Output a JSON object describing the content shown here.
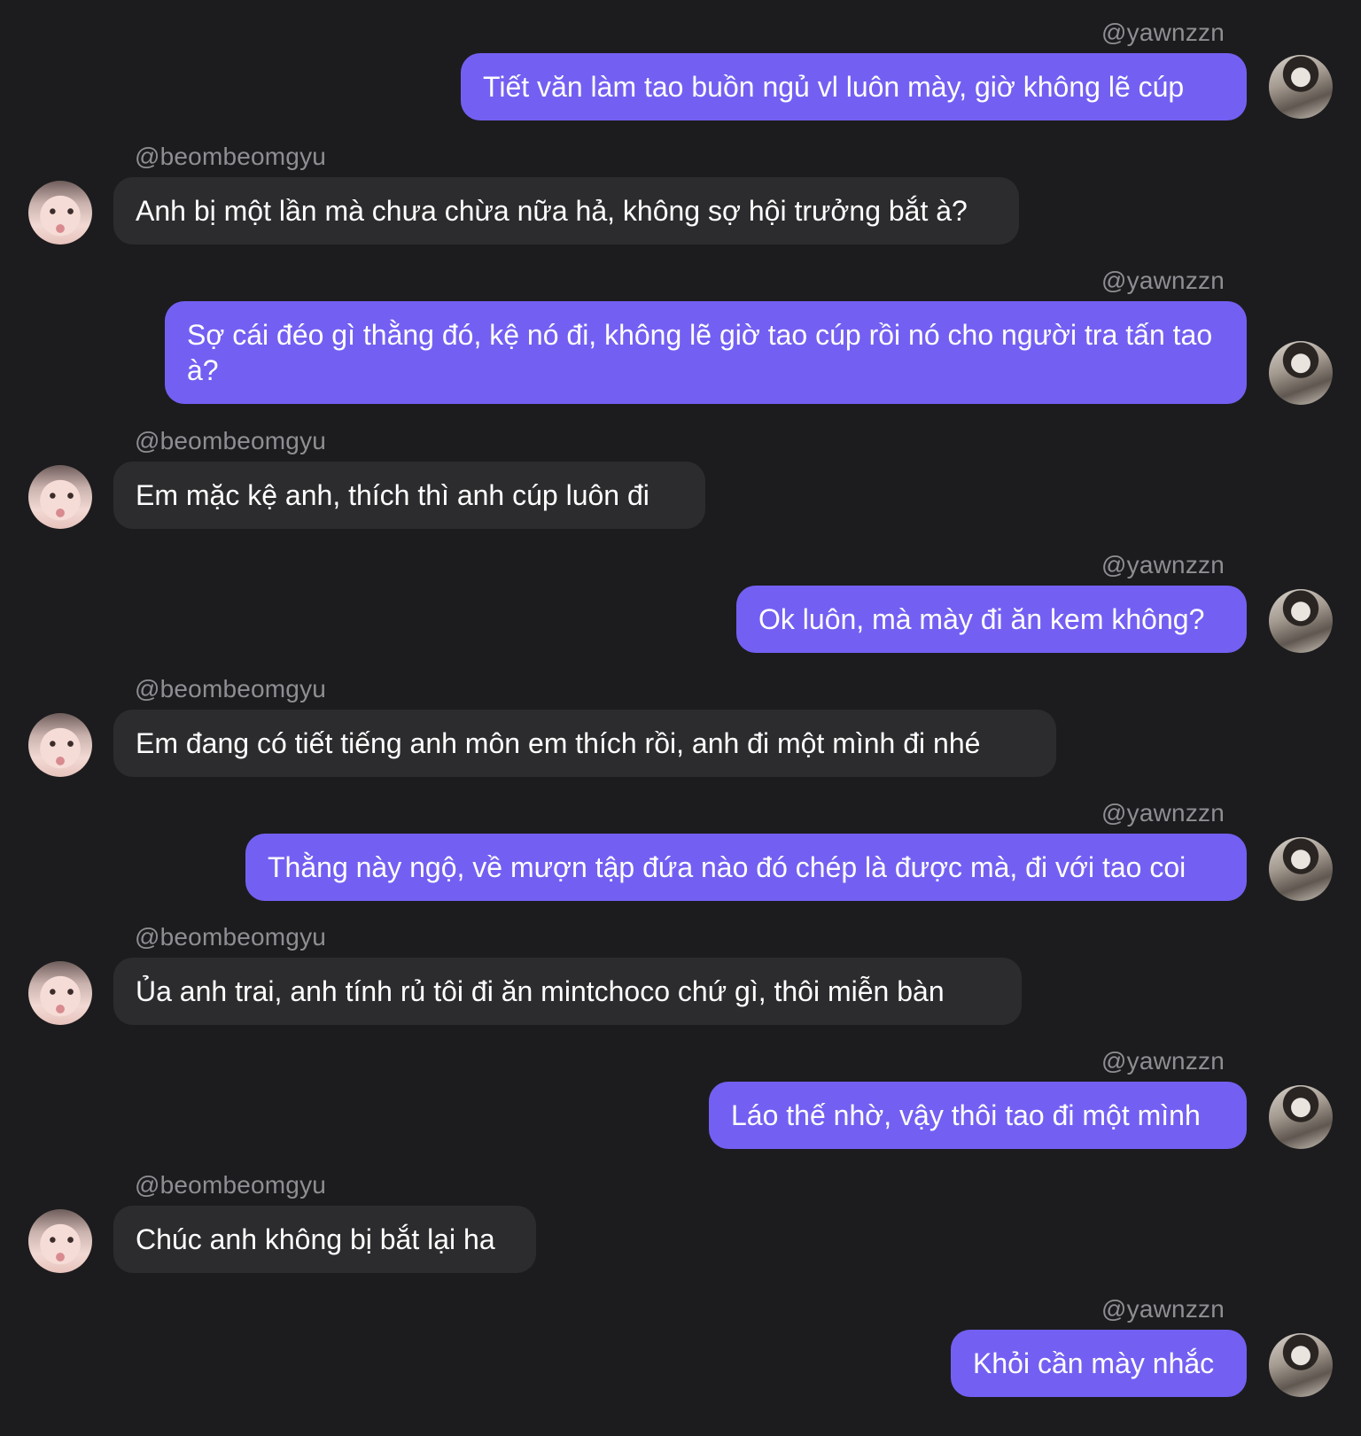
{
  "conversation": {
    "me": "@yawnzzn",
    "other": "@beombeomgyu",
    "messages": [
      {
        "sender": "@yawnzzn",
        "text": "Tiết văn làm tao buồn ngủ vl luôn mày, giờ không lẽ cúp"
      },
      {
        "sender": "@beombeomgyu",
        "text": "Anh bị một lần mà chưa chừa nữa hả, không sợ hội trưởng bắt à?"
      },
      {
        "sender": "@yawnzzn",
        "text": "Sợ cái đéo gì thằng đó, kệ nó đi, không lẽ giờ tao cúp rồi nó cho người tra tấn tao à?"
      },
      {
        "sender": "@beombeomgyu",
        "text": "Em mặc kệ anh, thích thì anh cúp luôn đi"
      },
      {
        "sender": "@yawnzzn",
        "text": "Ok luôn, mà mày đi ăn kem không?"
      },
      {
        "sender": "@beombeomgyu",
        "text": "Em đang có tiết tiếng anh môn em thích rồi, anh đi một mình đi nhé"
      },
      {
        "sender": "@yawnzzn",
        "text": "Thằng này ngộ, về mượn tập đứa nào đó chép là được mà, đi với tao coi"
      },
      {
        "sender": "@beombeomgyu",
        "text": "Ủa anh trai, anh tính rủ tôi đi ăn mintchoco chứ gì, thôi miễn bàn"
      },
      {
        "sender": "@yawnzzn",
        "text": "Láo thế nhờ, vậy thôi tao đi một mình"
      },
      {
        "sender": "@beombeomgyu",
        "text": "Chúc anh không bị bắt lại ha"
      },
      {
        "sender": "@yawnzzn",
        "text": "Khỏi cần mày nhắc"
      }
    ]
  },
  "colors": {
    "background": "#1c1c1e",
    "sent_bubble": "#7360f2",
    "received_bubble": "#2c2c2e",
    "username": "#8e8e93",
    "text": "#ffffff"
  },
  "icons": {
    "sent_avatar": "user-avatar-icon",
    "received_avatar": "contact-avatar-icon"
  }
}
